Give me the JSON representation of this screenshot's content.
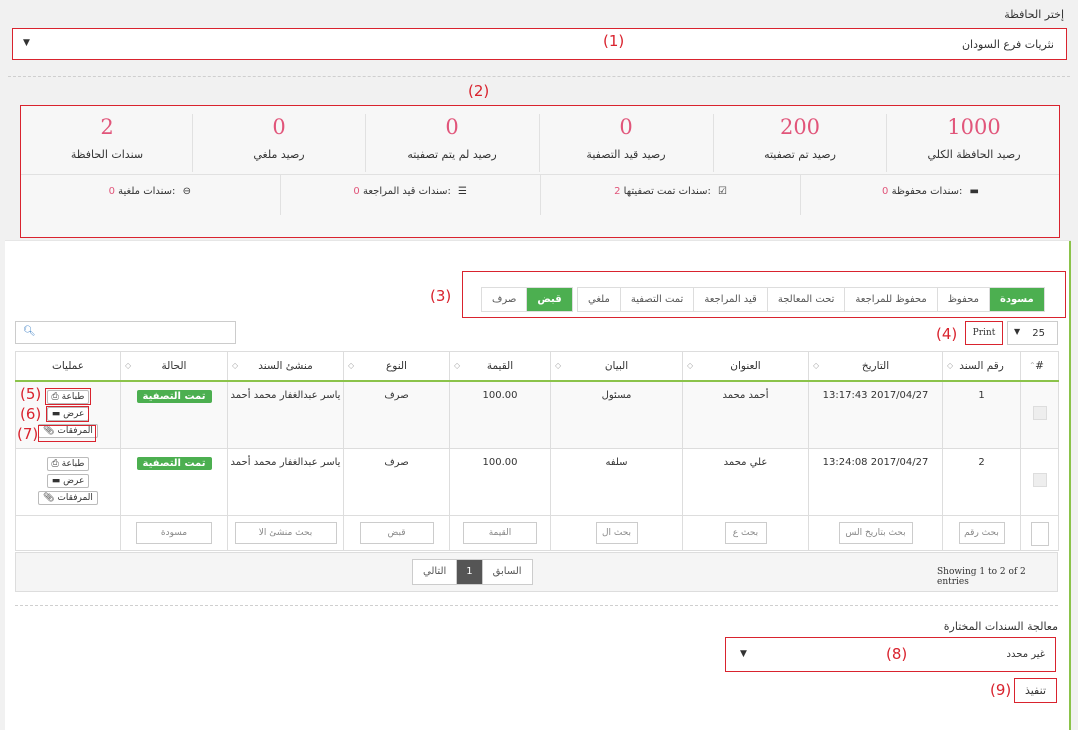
{
  "wallet": {
    "label": "إختر الحافظة",
    "selected": "نثريات فرع السودان"
  },
  "stats": [
    {
      "value": "1000",
      "label": "رصيد الحافظة الكلي"
    },
    {
      "value": "200",
      "label": "رصيد تم تصفيته"
    },
    {
      "value": "0",
      "label": "رصيد قيد التصفية"
    },
    {
      "value": "0",
      "label": "رصيد لم يتم تصفيته"
    },
    {
      "value": "0",
      "label": "رصيد ملغي"
    },
    {
      "value": "2",
      "label": "سندات الحافظة"
    }
  ],
  "substats": [
    {
      "label": "سندات محفوظة:",
      "count": "0"
    },
    {
      "label": "سندات تمت تصفيتها:",
      "count": "2"
    },
    {
      "label": "سندات قيد المراجعة:",
      "count": "0"
    },
    {
      "label": "سندات ملغية:",
      "count": "0"
    }
  ],
  "status_tabs": [
    "مسودة",
    "محفوظ",
    "محفوظ للمراجعة",
    "تحت المعالجة",
    "قيد المراجعة",
    "تمت التصفية",
    "ملغي"
  ],
  "type_tabs": [
    "قبض",
    "صرف"
  ],
  "controls": {
    "page_size": "25",
    "print_label": "Print"
  },
  "table": {
    "headers": [
      "#",
      "رقم السند",
      "التاريخ",
      "العنوان",
      "البيان",
      "القيمة",
      "النوع",
      "منشئ السند",
      "الحالة",
      "عمليات"
    ],
    "rows": [
      {
        "num": "1",
        "date": "2017/04/27 13:17:43",
        "title": "أحمد محمد",
        "desc": "مسئول",
        "amount": "100.00",
        "type": "صرف",
        "creator": "ياسر عبدالغفار محمد أحمد",
        "status": "تمت التصفية"
      },
      {
        "num": "2",
        "date": "2017/04/27 13:24:08",
        "title": "علي محمد",
        "desc": "سلفه",
        "amount": "100.00",
        "type": "صرف",
        "creator": "ياسر عبدالغفار محمد أحمد",
        "status": "تمت التصفية"
      }
    ],
    "actions": {
      "print": "طباعة",
      "view": "عرض",
      "attachments": "المرفقات"
    },
    "filters": [
      "بحث رقم",
      "بحث بتاريخ الس",
      "بحث ع",
      "بحث ال",
      "القيمة",
      "قبض",
      "بحث منشئ الا",
      "مسودة"
    ]
  },
  "footer": {
    "showing": "Showing 1 to 2 of 2 entries",
    "prev": "السابق",
    "page": "1",
    "next": "التالي"
  },
  "processing": {
    "title": "معالجة السندات المختارة",
    "selected": "غير محدد",
    "execute": "تنفيذ"
  },
  "annotations": [
    "(1)",
    "(2)",
    "(3)",
    "(4)",
    "(5)",
    "(6)",
    "(7)",
    "(8)",
    "(9)"
  ],
  "colors": {
    "accent_green": "#4caf50",
    "stat_pink": "#e1557a",
    "annotation_red": "#d9232e"
  }
}
